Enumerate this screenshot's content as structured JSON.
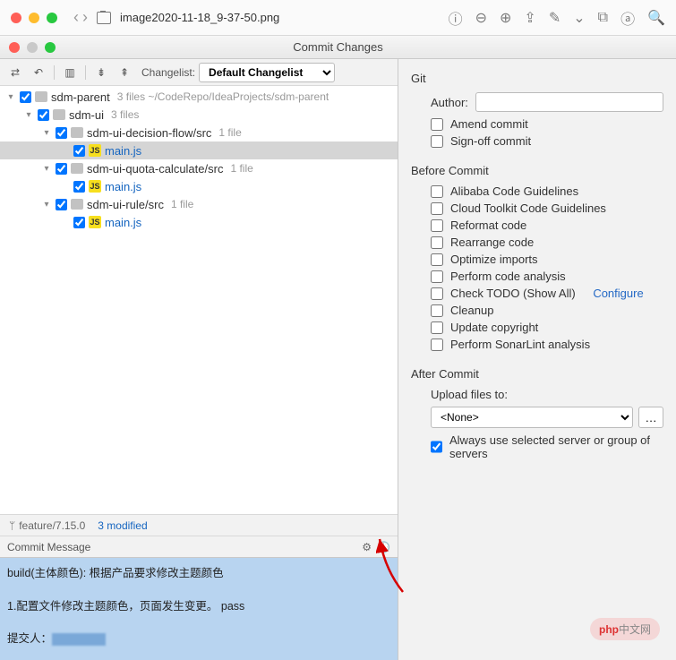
{
  "mac_titlebar": {
    "filename": "image2020-11-18_9-37-50.png"
  },
  "dialog": {
    "title": "Commit Changes"
  },
  "toolbar": {
    "changelist_label": "Changelist:",
    "changelist_value": "Default Changelist"
  },
  "tree": {
    "root": {
      "name": "sdm-parent",
      "meta": "3 files  ~/CodeRepo/IdeaProjects/sdm-parent"
    },
    "child1": {
      "name": "sdm-ui",
      "meta": "3 files"
    },
    "decision": {
      "name": "sdm-ui-decision-flow/src",
      "meta": "1 file",
      "file": "main.js"
    },
    "quota": {
      "name": "sdm-ui-quota-calculate/src",
      "meta": "1 file",
      "file": "main.js"
    },
    "rule": {
      "name": "sdm-ui-rule/src",
      "meta": "1 file",
      "file": "main.js"
    }
  },
  "status": {
    "branch": "feature/7.15.0",
    "modified": "3 modified"
  },
  "commit_message": {
    "header": "Commit Message",
    "line1": "build(主体颜色): 根据产品要求修改主题颜色",
    "line2": "1.配置文件修改主题颜色，页面发生变更。  pass",
    "line3": "提交人："
  },
  "git_panel": {
    "title": "Git",
    "author_label": "Author:",
    "amend": "Amend commit",
    "signoff": "Sign-off commit"
  },
  "before_commit": {
    "title": "Before Commit",
    "items": [
      "Alibaba Code Guidelines",
      "Cloud Toolkit Code Guidelines",
      "Reformat code",
      "Rearrange code",
      "Optimize imports",
      "Perform code analysis",
      "Check TODO (Show All)",
      "Cleanup",
      "Update copyright",
      "Perform SonarLint analysis"
    ],
    "configure": "Configure"
  },
  "after_commit": {
    "title": "After Commit",
    "upload_label": "Upload files to:",
    "upload_value": "<None>",
    "always_use": "Always use selected server or group of servers"
  },
  "watermark": {
    "prefix": "php",
    "suffix": "中文网"
  }
}
